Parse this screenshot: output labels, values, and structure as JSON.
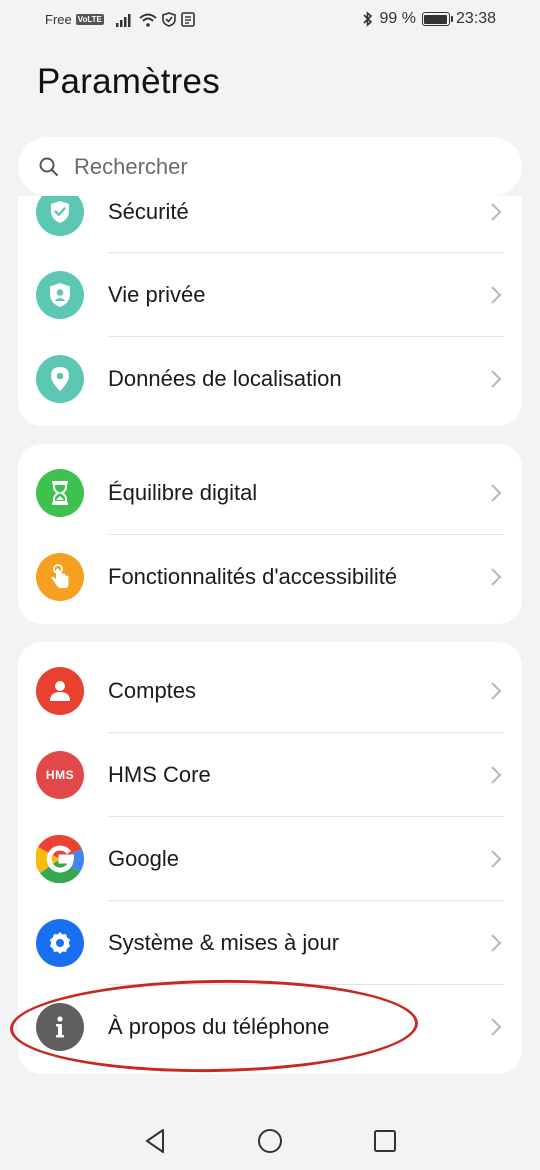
{
  "status_bar": {
    "carrier": "Free",
    "volte": "VoLTE",
    "battery_text": "99 %",
    "time": "23:38",
    "battery_level": 0.99
  },
  "page": {
    "title": "Paramètres"
  },
  "search": {
    "placeholder": "Rechercher"
  },
  "groups": [
    {
      "items": [
        {
          "label": "Sécurité",
          "icon": "shield-icon",
          "color": "#5cc8b4"
        },
        {
          "label": "Vie privée",
          "icon": "privacy-icon",
          "color": "#5cc8b4"
        },
        {
          "label": "Données de localisation",
          "icon": "location-pin-icon",
          "color": "#5cc8b4"
        }
      ]
    },
    {
      "items": [
        {
          "label": "Équilibre digital",
          "icon": "hourglass-icon",
          "color": "#3ec24f"
        },
        {
          "label": "Fonctionnalités d'accessibilité",
          "icon": "hand-icon",
          "color": "#f5a020"
        }
      ]
    },
    {
      "items": [
        {
          "label": "Comptes",
          "icon": "person-icon",
          "color": "#e8412f"
        },
        {
          "label": "HMS Core",
          "icon": "hms-icon",
          "color": "#e0484a",
          "icon_text": "HMS"
        },
        {
          "label": "Google",
          "icon": "google-icon",
          "color": "#ffffff"
        },
        {
          "label": "Système & mises à jour",
          "icon": "gear-icon",
          "color": "#1a6ff0"
        },
        {
          "label": "À propos du téléphone",
          "icon": "info-icon",
          "color": "#5f5f5f"
        }
      ]
    }
  ],
  "colors": {
    "background": "#f1f3f5",
    "card": "#ffffff",
    "annotation": "#c9281f"
  }
}
